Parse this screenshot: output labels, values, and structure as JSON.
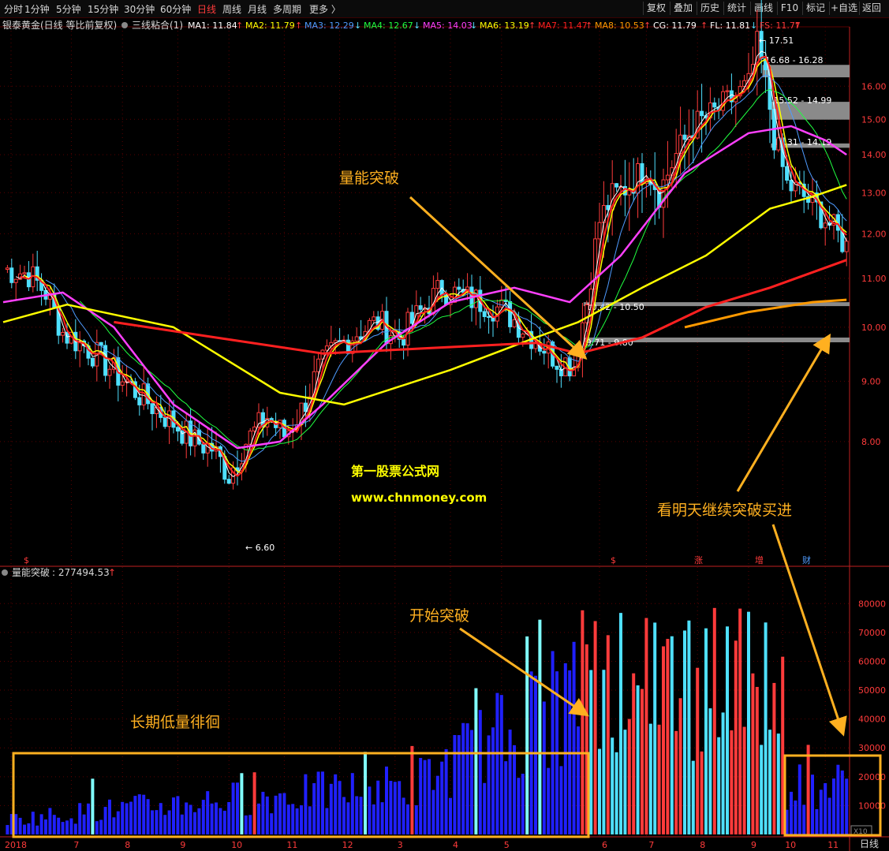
{
  "toolbar": {
    "tabs": [
      {
        "label": "分时",
        "x": 5
      },
      {
        "label": "1分钟",
        "x": 31
      },
      {
        "label": "5分钟",
        "x": 71
      },
      {
        "label": "15分钟",
        "x": 111
      },
      {
        "label": "30分钟",
        "x": 157
      },
      {
        "label": "60分钟",
        "x": 203
      },
      {
        "label": "日线",
        "x": 250,
        "active": true
      },
      {
        "label": "周线",
        "x": 282
      },
      {
        "label": "月线",
        "x": 314
      },
      {
        "label": "多周期",
        "x": 346
      },
      {
        "label": "更多 〉",
        "x": 392
      }
    ],
    "buttons": [
      "复权",
      "叠加",
      "历史",
      "统计",
      "画线",
      "F10",
      "标记",
      "+自选",
      "返回"
    ]
  },
  "colors": {
    "up": "#ff3b3b",
    "down": "#4fe0ff",
    "ma_white": "#ffffff",
    "ma_yellow": "#ffff00",
    "ma_blue": "#4f9bff",
    "ma_green": "#20ff40",
    "ma_magenta": "#ff40ff",
    "ma_red": "#ff2020",
    "ma_orange": "#ff9900",
    "grid": "#5a0000",
    "axis": "#c02020",
    "annot": "#ffb020",
    "gap": "#8a8a8a",
    "volume": "#2020ff"
  },
  "header": {
    "stock": "银泰黄金(日线 等比前复权)",
    "indicator": "三线粘合(1)",
    "ma_items": [
      {
        "label": "MA1: 11.84",
        "arrow": "↑",
        "color": "#ffffff"
      },
      {
        "label": "MA2: 11.79",
        "arrow": "↑",
        "color": "#ffff00"
      },
      {
        "label": "MA3: 12.29",
        "arrow": "↓",
        "color": "#4f9bff"
      },
      {
        "label": "MA4: 12.67",
        "arrow": "↓",
        "color": "#20ff40"
      },
      {
        "label": "MA5: 14.03",
        "arrow": "↓",
        "color": "#ff40ff"
      },
      {
        "label": "MA6: 13.19",
        "arrow": "↑",
        "color": "#ffff00"
      },
      {
        "label": "MA7: 11.47",
        "arrow": "↑",
        "color": "#ff2020"
      },
      {
        "label": "MA8: 10.53",
        "arrow": "↑",
        "color": "#ff9900"
      },
      {
        "label": "CG: 11.79",
        "arrow": "↑",
        "color": "#ffffff"
      },
      {
        "label": "FL: 11.81",
        "arrow": "↓",
        "color": "#ffffff"
      },
      {
        "label": "FS: 11.77",
        "arrow": "↑",
        "color": "#ff3b3b"
      }
    ]
  },
  "volume_header": {
    "label": "量能突破",
    "value": ": 277494.53",
    "arrow": "↑"
  },
  "price_labels": {
    "high": "17.51",
    "low": "6.60"
  },
  "gap_labels": [
    "16.68 - 16.28",
    "15.52 - 14.99",
    "14.31 - 14.19",
    "10.42 - 10.50",
    "9.71 - 9.80"
  ],
  "event_markers": [
    "$",
    "$",
    "涨",
    "增",
    "财"
  ],
  "annotations": {
    "volume_breakout": "量能突破",
    "start_breakout": "开始突破",
    "long_low_volume": "长期低量徘徊",
    "buy_tomorrow": "看明天继续突破买进",
    "watermark_name": "第一股票公式网",
    "watermark_url": "www.chnmoney.com"
  },
  "right_bottom_label": "日线",
  "volume_multiplier": "X10",
  "chart_data": {
    "type": "candlestick",
    "price_axis": {
      "ticks": [
        8.0,
        9.0,
        10.0,
        11.0,
        12.0,
        13.0,
        14.0,
        15.0,
        16.0
      ],
      "range": [
        6.4,
        17.8
      ],
      "scale": "log"
    },
    "volume_axis": {
      "ticks": [
        10000,
        20000,
        30000,
        40000,
        50000,
        60000,
        70000,
        80000
      ],
      "range": [
        0,
        88000
      ]
    },
    "x_ticks": [
      "2018",
      "7",
      "8",
      "9",
      "10",
      "11",
      "12",
      "3",
      "4",
      "5",
      "6",
      "7",
      "8",
      "9",
      "10",
      "11"
    ],
    "price_path": [
      [
        0,
        11.2
      ],
      [
        6,
        11.1
      ],
      [
        10,
        10.7
      ],
      [
        14,
        9.9
      ],
      [
        20,
        9.6
      ],
      [
        27,
        9.1
      ],
      [
        33,
        8.7
      ],
      [
        40,
        8.3
      ],
      [
        45,
        8.0
      ],
      [
        49,
        7.9
      ],
      [
        53,
        7.5
      ],
      [
        57,
        8.0
      ],
      [
        62,
        8.4
      ],
      [
        66,
        8.1
      ],
      [
        70,
        8.5
      ],
      [
        74,
        9.2
      ],
      [
        78,
        9.6
      ],
      [
        83,
        9.9
      ],
      [
        88,
        10.1
      ],
      [
        93,
        9.8
      ],
      [
        98,
        10.3
      ],
      [
        103,
        10.8
      ],
      [
        108,
        10.6
      ],
      [
        113,
        10.5
      ],
      [
        118,
        10.3
      ],
      [
        122,
        10.0
      ],
      [
        126,
        9.7
      ],
      [
        130,
        9.4
      ],
      [
        134,
        9.3
      ],
      [
        137,
        10.5
      ],
      [
        140,
        12.3
      ],
      [
        143,
        12.9
      ],
      [
        147,
        13.2
      ],
      [
        151,
        13.7
      ],
      [
        154,
        13.0
      ],
      [
        158,
        14.0
      ],
      [
        162,
        14.8
      ],
      [
        167,
        15.2
      ],
      [
        171,
        15.6
      ],
      [
        175,
        16.0
      ],
      [
        177,
        17.3
      ],
      [
        179,
        16.2
      ],
      [
        181,
        14.5
      ],
      [
        184,
        13.2
      ],
      [
        187,
        13.0
      ],
      [
        191,
        12.6
      ],
      [
        195,
        12.1
      ],
      [
        198,
        11.7
      ]
    ],
    "volume_segments": [
      {
        "from": 0,
        "to": 50,
        "level": 5000
      },
      {
        "from": 50,
        "to": 96,
        "level": 12000
      },
      {
        "from": 96,
        "to": 136,
        "level": 17000
      },
      {
        "from": 136,
        "to": 183,
        "level": 50000
      },
      {
        "from": 183,
        "to": 198,
        "level": 17000
      }
    ],
    "moving_averages": [
      {
        "name": "MA5",
        "color": "#ff40ff",
        "points": [
          [
            0,
            10.5
          ],
          [
            14,
            10.7
          ],
          [
            26,
            10.0
          ],
          [
            40,
            8.6
          ],
          [
            55,
            7.9
          ],
          [
            65,
            8.0
          ],
          [
            75,
            8.6
          ],
          [
            90,
            9.7
          ],
          [
            105,
            10.5
          ],
          [
            120,
            10.8
          ],
          [
            133,
            10.5
          ],
          [
            145,
            11.5
          ],
          [
            160,
            13.5
          ],
          [
            175,
            14.6
          ],
          [
            185,
            14.8
          ],
          [
            193,
            14.4
          ],
          [
            198,
            14.0
          ]
        ]
      },
      {
        "name": "MA6",
        "color": "#ffff00",
        "points": [
          [
            0,
            10.1
          ],
          [
            15,
            10.45
          ],
          [
            40,
            10.0
          ],
          [
            65,
            8.8
          ],
          [
            80,
            8.6
          ],
          [
            105,
            9.2
          ],
          [
            125,
            9.8
          ],
          [
            135,
            10.1
          ],
          [
            150,
            10.8
          ],
          [
            165,
            11.5
          ],
          [
            180,
            12.6
          ],
          [
            190,
            12.9
          ],
          [
            198,
            13.2
          ]
        ]
      },
      {
        "name": "MA7",
        "color": "#ff2020",
        "points": [
          [
            26,
            10.1
          ],
          [
            50,
            9.8
          ],
          [
            75,
            9.5
          ],
          [
            100,
            9.6
          ],
          [
            125,
            9.7
          ],
          [
            135,
            9.5
          ],
          [
            150,
            9.8
          ],
          [
            165,
            10.4
          ],
          [
            180,
            10.8
          ],
          [
            198,
            11.4
          ]
        ]
      },
      {
        "name": "MA8",
        "color": "#ff9900",
        "points": [
          [
            160,
            10.0
          ],
          [
            175,
            10.3
          ],
          [
            190,
            10.5
          ],
          [
            198,
            10.55
          ]
        ]
      }
    ]
  }
}
